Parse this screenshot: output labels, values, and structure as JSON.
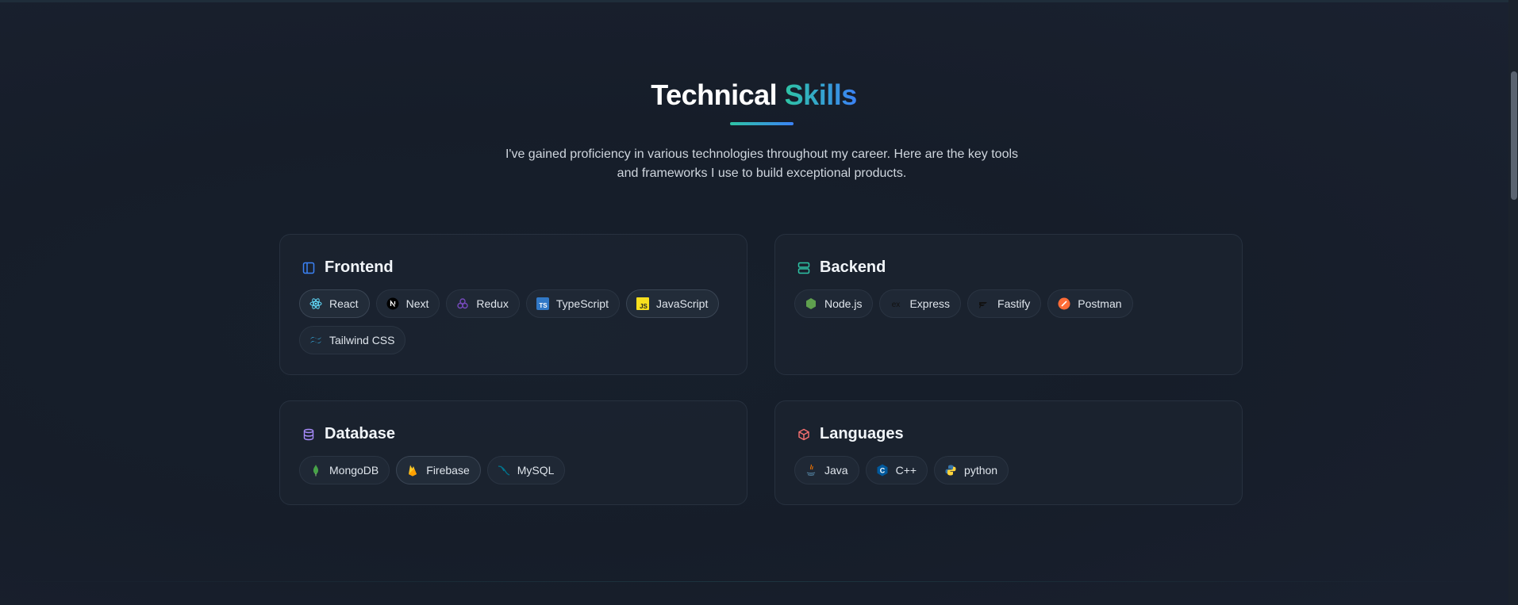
{
  "header": {
    "title_part1": "Technical",
    "title_part2": "Skills",
    "subtitle": "I've gained proficiency in various technologies throughout my career. Here are the key tools and frameworks I use to build exceptional products."
  },
  "colors": {
    "accent_start": "#2ec4a5",
    "accent_end": "#3b82f6",
    "background": "#161d29"
  },
  "categories": [
    {
      "name": "Frontend",
      "icon": "layout-panel-icon",
      "skills": [
        {
          "label": "React",
          "icon": "react-icon"
        },
        {
          "label": "Next",
          "icon": "nextjs-icon"
        },
        {
          "label": "Redux",
          "icon": "redux-icon"
        },
        {
          "label": "TypeScript",
          "icon": "typescript-icon"
        },
        {
          "label": "JavaScript",
          "icon": "javascript-icon"
        },
        {
          "label": "Tailwind CSS",
          "icon": "tailwind-icon"
        }
      ]
    },
    {
      "name": "Backend",
      "icon": "server-icon",
      "skills": [
        {
          "label": "Node.js",
          "icon": "nodejs-icon"
        },
        {
          "label": "Express",
          "icon": "express-icon"
        },
        {
          "label": "Fastify",
          "icon": "fastify-icon"
        },
        {
          "label": "Postman",
          "icon": "postman-icon"
        }
      ]
    },
    {
      "name": "Database",
      "icon": "database-icon",
      "skills": [
        {
          "label": "MongoDB",
          "icon": "mongodb-icon"
        },
        {
          "label": "Firebase",
          "icon": "firebase-icon"
        },
        {
          "label": "MySQL",
          "icon": "mysql-icon"
        }
      ]
    },
    {
      "name": "Languages",
      "icon": "cube-icon",
      "skills": [
        {
          "label": "Java",
          "icon": "java-icon"
        },
        {
          "label": "C++",
          "icon": "cpp-icon"
        },
        {
          "label": "python",
          "icon": "python-icon"
        }
      ]
    }
  ]
}
